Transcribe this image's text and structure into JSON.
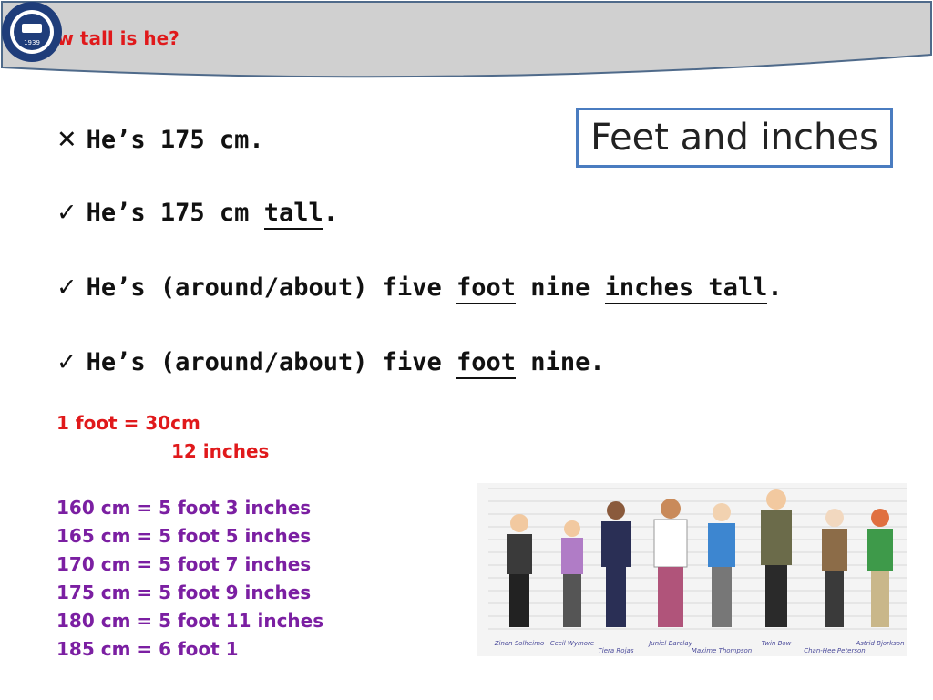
{
  "header": {
    "title": "How tall is he?",
    "logo_text": "1939",
    "logo_caption": "HANYANG UNIVERSITY"
  },
  "topic_box": {
    "label": "Feet and inches"
  },
  "sentences": [
    {
      "mark": "✕",
      "pre": "He’s 175 cm.",
      "ul": "",
      "post": ""
    },
    {
      "mark": "✓",
      "pre": "He’s 175 cm ",
      "ul": "tall",
      "post": "."
    },
    {
      "mark": "✓",
      "pre": "He’s (around/about) five ",
      "ul1": "foot",
      "mid": " nine ",
      "ul2": "inches tall",
      "post": "."
    },
    {
      "mark": "✓",
      "pre": "He’s (around/about) five ",
      "ul": "foot",
      "post": " nine."
    }
  ],
  "conversion": {
    "line1": "1 foot =  30cm",
    "line2": "12 inches",
    "rows": [
      "160 cm = 5 foot 3 inches",
      "165 cm = 5 foot 5 inches",
      "170 cm = 5 foot 7 inches",
      "175 cm = 5 foot 9 inches",
      "180 cm = 5 foot 11 inches",
      "185 cm = 6 foot 1"
    ]
  },
  "figure": {
    "names": [
      "Zinan Solheimo",
      "Cecil Wymore",
      "Tiera Rojas",
      "Juniel Barclay",
      "Maxime Thompson",
      "Twin Bow",
      "Chan-Hee Peterson",
      "Astrid Bjorkson"
    ]
  },
  "colors": {
    "title_red": "#e0191b",
    "conversion_red": "#e0191b",
    "conversion_purple": "#7b1fa2",
    "box_border": "#4a7cc0"
  }
}
